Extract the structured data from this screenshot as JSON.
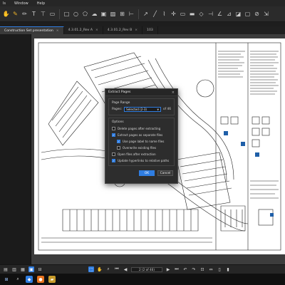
{
  "menu": {
    "items": [
      "ls",
      "Window",
      "Help"
    ]
  },
  "toolbar": {
    "accent": "#f0b429"
  },
  "tabs": [
    {
      "label": "Construction Set presentation",
      "active": true
    },
    {
      "label": "4.3.01.2_Rev A",
      "active": false
    },
    {
      "label": "4.3.01.2_Rev B",
      "active": false
    },
    {
      "label": "103",
      "active": false
    }
  ],
  "dialog": {
    "title": "Extract Pages",
    "close": "×",
    "page_range": {
      "group_title": "Page Range",
      "pages_label": "Pages:",
      "selected_value": "Selected (2-3)",
      "of_label": "of 46"
    },
    "options": {
      "group_title": "Options",
      "delete_pages": {
        "label": "Delete pages after extracting",
        "checked": false
      },
      "separate_files": {
        "label": "Extract pages as separate files",
        "checked": true
      },
      "use_page_label": {
        "label": "Use page label to name files",
        "checked": true
      },
      "overwrite": {
        "label": "Overwrite existing files",
        "checked": false
      },
      "open_files": {
        "label": "Open files after extraction",
        "checked": false
      },
      "update_hyperlinks": {
        "label": "Update hyperlinks to relative paths",
        "checked": true
      }
    },
    "ok_label": "OK",
    "cancel_label": "Cancel"
  },
  "status": {
    "page_field": "2 (2 of 46)"
  },
  "colors": {
    "accent_blue": "#2f7de1",
    "dark_bg": "#1e1e1e"
  }
}
